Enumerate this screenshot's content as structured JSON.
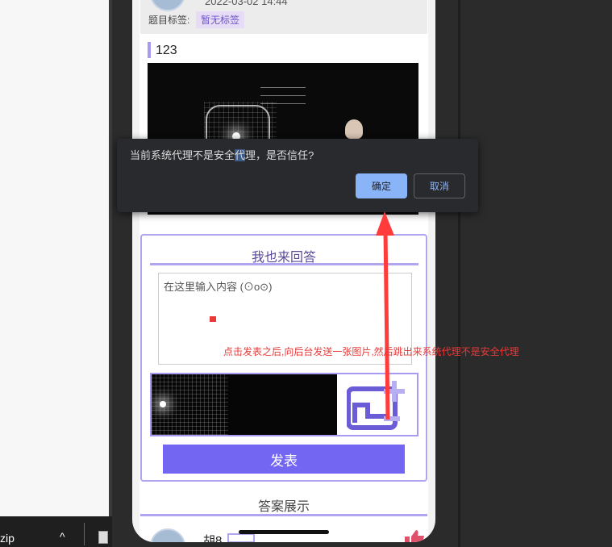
{
  "question": {
    "date": "2022-03-02 14:44",
    "tag_label": "题目标签:",
    "tag_value": "暂无标签",
    "content_text": "123"
  },
  "answer_form": {
    "title": "我也来回答",
    "input_placeholder": "在这里输入内容 (⊙o⊙)",
    "submit_label": "发表"
  },
  "answers": {
    "title": "答案展示",
    "first_name": "胡8"
  },
  "dialog": {
    "message_before": "当前系统代理不是安全",
    "message_highlight": "代",
    "message_after": "理，是否信任?",
    "ok_label": "确定",
    "cancel_label": "取消"
  },
  "annotation": {
    "text": "点击发表之后,向后台发送一张图片,然后跳出来系统代理不是安全代理",
    "color": "#e83a3a"
  },
  "taskbar": {
    "zip_label": "zip",
    "caret": "^"
  },
  "colors": {
    "accent": "#7266f3",
    "border": "#b0a6f0",
    "dialog_bg": "#292a2d",
    "dialog_button": "#8ab4f8"
  }
}
